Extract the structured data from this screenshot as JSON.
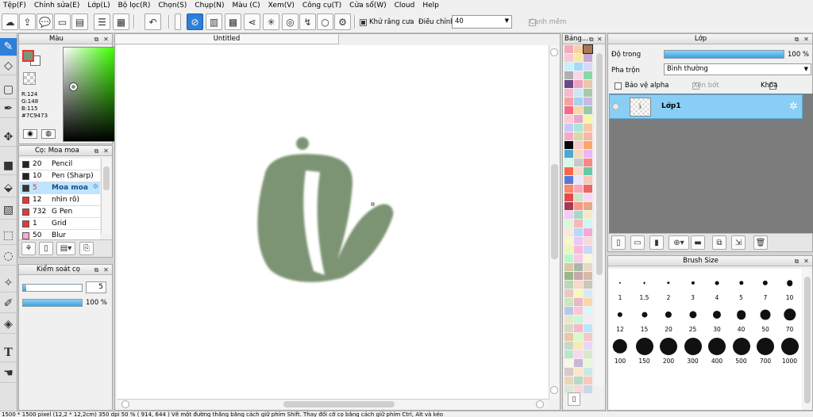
{
  "menu": [
    "Tệp(F)",
    "Chỉnh sửa(E)",
    "Lớp(L)",
    "Bộ lọc(R)",
    "Chọn(S)",
    "Chụp(N)",
    "Màu (C)",
    "Xem(V)",
    "Công cụ(T)",
    "Cửa sổ(W)",
    "Cloud",
    "Help"
  ],
  "toolbar": {
    "antialias_label": "Khử răng cưa",
    "adjust_label": "Điều chỉnh",
    "adjust_value": "40",
    "edge_label": "Cạnh mềm"
  },
  "color_panel": {
    "title": "Màu",
    "r": "R:124",
    "g": "G:148",
    "b": "B:115",
    "hex": "#7C9473",
    "main_color": "#7C9473",
    "sub_color": "#ffffff",
    "sv_cursor_pct": {
      "x": 20,
      "y": 42
    },
    "hue_cursor_pct": 70
  },
  "brush_panel": {
    "title": "Cọ: Moa moa",
    "items": [
      {
        "size": "20",
        "name": "Pencil",
        "color": "#222222"
      },
      {
        "size": "10",
        "name": "Pen (Sharp)",
        "color": "#222222"
      },
      {
        "size": "5",
        "name": "Moa moa",
        "color": "#333333"
      },
      {
        "size": "12",
        "name": "nhìn rõ)",
        "color": "#e53935"
      },
      {
        "size": "732",
        "name": "G Pen",
        "color": "#e53935"
      },
      {
        "size": "1",
        "name": "Grid",
        "color": "#e53935"
      },
      {
        "size": "50",
        "name": "Blur",
        "color": "#ffaad4"
      }
    ]
  },
  "brush_control": {
    "title": "Kiểm soát cọ",
    "size_value": "5",
    "size_fraction": 0.05,
    "opacity_label": "100 %",
    "opacity_fraction": 1.0
  },
  "canvas": {
    "tab_title": "Untitled",
    "stroke_color": "#7C9473"
  },
  "palette": {
    "title": "Bảng...",
    "colors": [
      "#f8a8b8",
      "#f8d0a8",
      "#a87850",
      "#f8c8d8",
      "#f8e8a8",
      "#c8a8d8",
      "#c8f0f8",
      "#a8d8f8",
      "#d8d8f8",
      "#b0b0b0",
      "#f8d8e8",
      "#88d8a8",
      "#684888",
      "#f0a0c0",
      "#e8c8a8",
      "#f8b8c8",
      "#c8e8f8",
      "#a8c8a8",
      "#f8a0a0",
      "#a8d0f0",
      "#c8b8e8",
      "#f86888",
      "#f8d8a8",
      "#98c8a8",
      "#ffc8d8",
      "#e8a8c8",
      "#f8f8a8",
      "#c8c8f8",
      "#a8e8d8",
      "#f8c8a8",
      "#f8a8c8",
      "#d8d8a8",
      "#f8b8a8",
      "#080808",
      "#f8c8c8",
      "#f8a868",
      "#48a8d8",
      "#f8d8b8",
      "#e8b8f8",
      "#d8f8e8",
      "#c8c8c8",
      "#f88888",
      "#f86848",
      "#f8d8c8",
      "#68c8a8",
      "#5878d8",
      "#e8e8f8",
      "#f8c8b8",
      "#f88868",
      "#f8a8b8",
      "#e86868",
      "#e84848",
      "#c8e8c8",
      "#f8d8f8",
      "#a83858",
      "#f89888",
      "#e8a888",
      "#f8c8f8",
      "#a8d8c8",
      "#f8e8c8",
      "#d8f8d8",
      "#f8b8b8",
      "#c8f8f8",
      "#f8e8d8",
      "#b8d8f8",
      "#f8a8d8",
      "#f8f8c8",
      "#e8c8f8",
      "#f8d8d8",
      "#e8f8b8",
      "#f8b8d8",
      "#c8d8f8",
      "#b8f8c8",
      "#f8c8e8",
      "#f8f8d8",
      "#d8c8a8",
      "#a8b8a8",
      "#e8d8c8",
      "#98b888",
      "#c8a8a8",
      "#d8b8a8",
      "#b8d8b8",
      "#f8d8c8",
      "#c8c8b8",
      "#e8c8c8",
      "#f8f8b8",
      "#d8e8f8",
      "#c8e8b8",
      "#e8b8c8",
      "#f8d8a8",
      "#b8c8e8",
      "#f8c8d8",
      "#d8f8f8",
      "#e8e8c8",
      "#c8f8d8",
      "#f8e8f8",
      "#d8d8c8",
      "#f8b8c8",
      "#b8e8f8",
      "#e8c8a8",
      "#d8f8c8",
      "#f8c8c8",
      "#c8d8c8",
      "#f8e8b8",
      "#e8d8f8",
      "#b8e8c8",
      "#f8d8e8",
      "#d8e8c8",
      "#f8f8e8",
      "#c8b8d8",
      "#e8f8d8",
      "#d8c8c8",
      "#f8e8c8",
      "#c8e8e8",
      "#e8d8b8",
      "#b8d8c8",
      "#f8c8b8",
      "#d8e8d8",
      "#f8d8d8",
      "#c8d8e8"
    ]
  },
  "layer_panel": {
    "title": "Lớp",
    "opacity_label": "Độ trong",
    "opacity_value": "100 %",
    "opacity_fraction": 1.0,
    "blend_label": "Pha trộn",
    "blend_value": "Bình thường",
    "protect_alpha": "Bảo vệ alpha",
    "clipping": "Xén bớt",
    "lock": "Khóa",
    "layer_name": "Lớp1"
  },
  "brush_size_panel": {
    "title": "Brush Size",
    "sizes": [
      "1",
      "1.5",
      "2",
      "3",
      "4",
      "5",
      "7",
      "10",
      "12",
      "15",
      "20",
      "25",
      "30",
      "40",
      "50",
      "70",
      "100",
      "150",
      "200",
      "300",
      "400",
      "500",
      "700",
      "1000"
    ]
  },
  "status": "1500 * 1500 pixel   (12,2 * 12,2cm)   350 dpi   50 %   ( 914, 644 )   Vẽ một đường thẳng bằng cách giữ phím Shift. Thay đổi cỡ cọ bằng cách giữ phím Ctrl, Alt và kéo"
}
